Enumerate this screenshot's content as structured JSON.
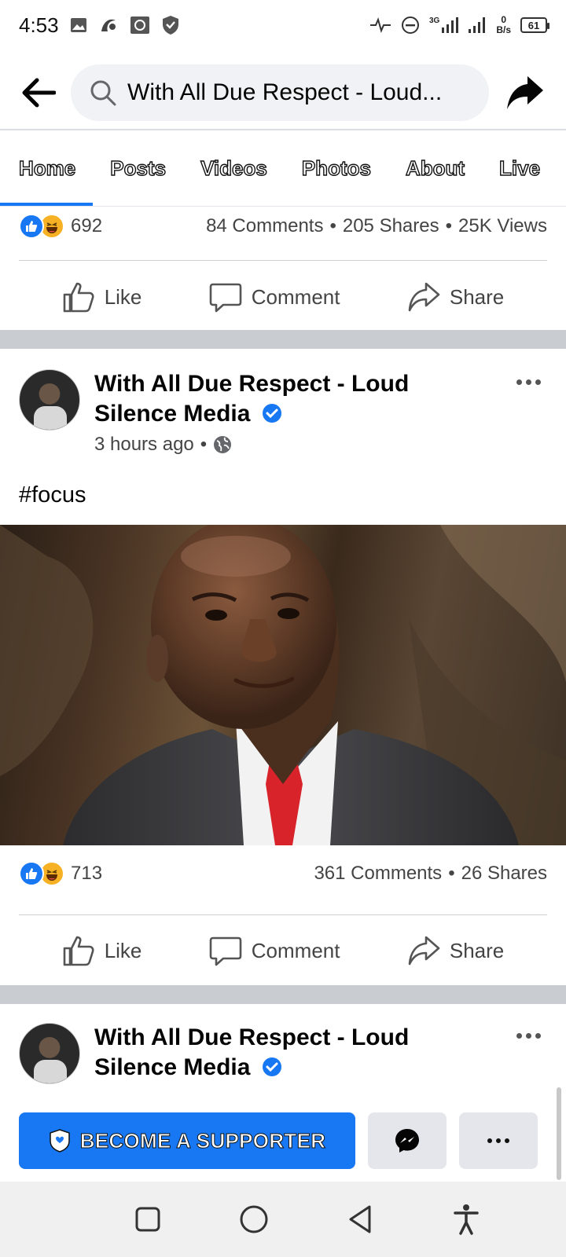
{
  "status_bar": {
    "time": "4:53",
    "net_speed_value": "0",
    "net_speed_unit": "B/s",
    "battery": "61",
    "network_label": "3G"
  },
  "header": {
    "search_text": "With All Due Respect - Loud...",
    "icons": [
      "back-arrow-icon",
      "search-icon",
      "share-icon"
    ]
  },
  "tabs": [
    {
      "label": "Home",
      "active": true
    },
    {
      "label": "Posts"
    },
    {
      "label": "Videos"
    },
    {
      "label": "Photos"
    },
    {
      "label": "About"
    },
    {
      "label": "Live"
    }
  ],
  "prev_post": {
    "reactions_count": "692",
    "comments": "84 Comments",
    "shares": "205 Shares",
    "views": "25K Views",
    "separator": "•"
  },
  "actions": {
    "like": "Like",
    "comment": "Comment",
    "share": "Share"
  },
  "post1": {
    "page_name_line1": "With All Due Respect - Loud",
    "page_name_line2": "Silence Media",
    "time": "3 hours ago",
    "dot": "•",
    "text": "#focus",
    "reactions_count": "713",
    "comments": "361 Comments",
    "shares": "26 Shares",
    "separator": "•"
  },
  "post2": {
    "page_name_line1": "With All Due Respect - Loud",
    "page_name_line2": "Silence Media"
  },
  "page_actions": {
    "supporter_label": "BECOME A SUPPORTER"
  },
  "colors": {
    "facebook_blue": "#1877f2",
    "separator_gray": "#c9ccd1",
    "button_gray": "#e4e6eb"
  }
}
